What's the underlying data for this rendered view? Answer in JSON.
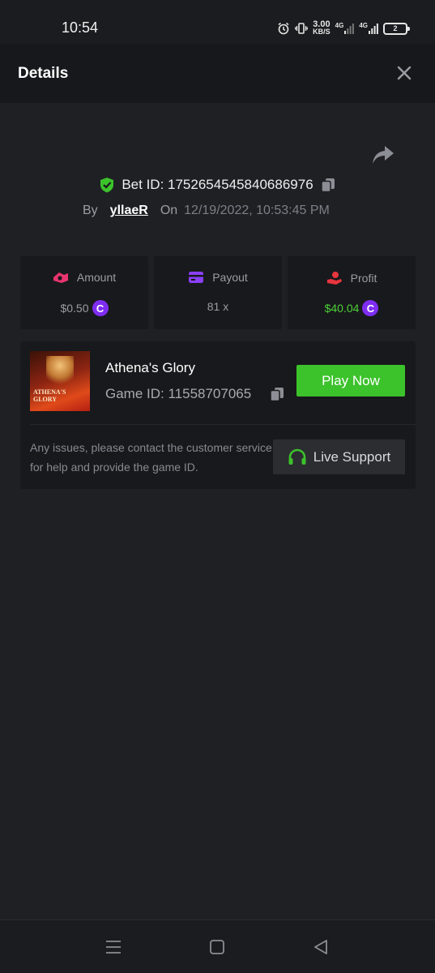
{
  "status_bar": {
    "time": "10:54",
    "net_speed_value": "3.00",
    "net_speed_unit": "KB/S",
    "network_1": "4G",
    "network_2": "4G",
    "battery": "2"
  },
  "header": {
    "title": "Details",
    "close_icon": "close-icon"
  },
  "bet": {
    "label": "Bet ID: 1752654545840686976",
    "by_label": "By",
    "user": "yllaeR",
    "on_label": "On",
    "datetime": "12/19/2022, 10:53:45 PM"
  },
  "stats": {
    "amount": {
      "label": "Amount",
      "value": "$0.50"
    },
    "payout": {
      "label": "Payout",
      "value": "81 x"
    },
    "profit": {
      "label": "Profit",
      "value": "$40.04"
    }
  },
  "coin_symbol": "C",
  "game": {
    "name": "Athena's Glory",
    "id_label": "Game ID: 11558707065",
    "thumb_text": "ATHENA'S GLORY",
    "play_label": "Play Now",
    "support_text": "Any issues, please contact the customer service for help and provide the game ID.",
    "support_label": "Live Support"
  },
  "colors": {
    "background": "#1f2024",
    "card": "#18191c",
    "accent_green": "#3cc22b",
    "profit_green": "#4cd137",
    "coin_purple": "#7e2df0",
    "amount_pink": "#e8356f",
    "payout_purple": "#8a3ff5",
    "profit_red": "#e8353e"
  }
}
